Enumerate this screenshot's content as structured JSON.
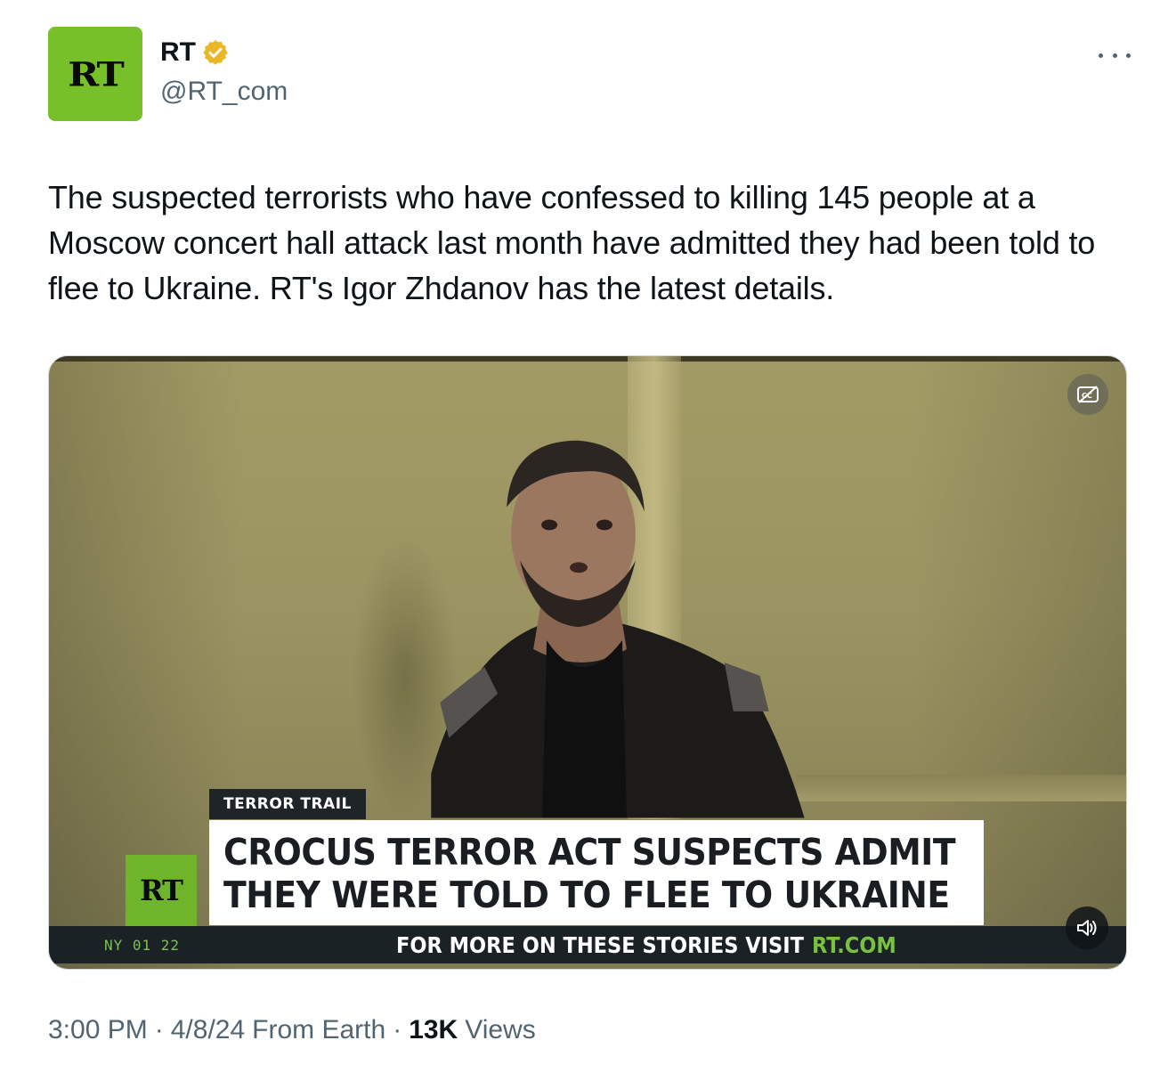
{
  "author": {
    "avatar_text": "RT",
    "display_name": "RT",
    "handle": "@RT_com",
    "brand_color": "#77c02a",
    "verified_badge_color": "#e8b829"
  },
  "tweet": {
    "text": "The suspected terrorists who have confessed to killing 145 people at a Moscow concert hall attack last month have admitted they had been told to flee to Ukraine. RT's Igor Zhdanov has the latest details."
  },
  "video": {
    "tag": "TERROR TRAIL",
    "headline_line1": "CROCUS TERROR ACT SUSPECTS ADMIT",
    "headline_line2": "THEY WERE TOLD TO FLEE TO UKRAINE",
    "bug_text": "RT",
    "clock": "NY  01 22",
    "ticker_text": "FOR MORE ON THESE STORIES VISIT",
    "ticker_link": "RT.COM",
    "captions_icon": "captions-off-icon",
    "volume_icon": "volume-icon"
  },
  "meta": {
    "time": "3:00 PM",
    "date": "4/8/24",
    "source": "From Earth",
    "views_count": "13K",
    "views_label": "Views",
    "separator": "·"
  }
}
